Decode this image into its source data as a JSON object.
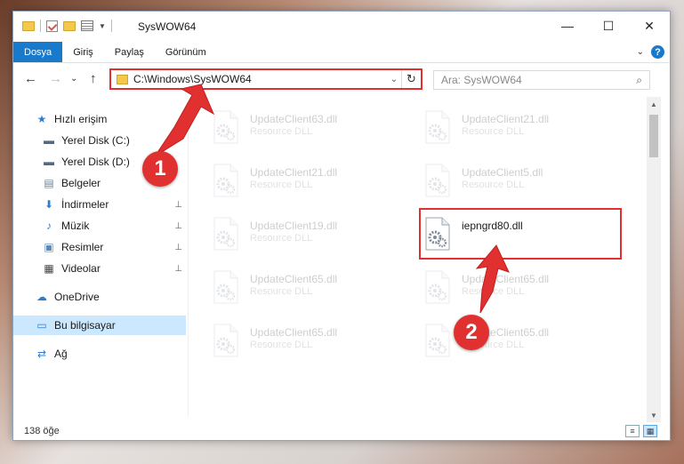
{
  "window": {
    "title": "SysWOW64",
    "controls": {
      "minimize": "—",
      "maximize": "☐",
      "close": "✕"
    }
  },
  "ribbon": {
    "tabs": [
      {
        "label": "Dosya",
        "active": true
      },
      {
        "label": "Giriş",
        "active": false
      },
      {
        "label": "Paylaş",
        "active": false
      },
      {
        "label": "Görünüm",
        "active": false
      }
    ],
    "help_caret": "⌄",
    "help_glyph": "?"
  },
  "address": {
    "path": "C:\\Windows\\SysWOW64",
    "dropdown_glyph": "⌄",
    "refresh_glyph": "↻"
  },
  "nav_buttons": {
    "back": "←",
    "forward": "→",
    "recent": "⌄",
    "up": "↑"
  },
  "search": {
    "placeholder": "Ara: SysWOW64",
    "icon_glyph": "⌕"
  },
  "sidebar": {
    "items": [
      {
        "label": "Hızlı erişim",
        "icon": "star-icon",
        "glyph": "★",
        "color": "#2a7fd4",
        "pinned": false
      },
      {
        "label": "Yerel Disk (C:)",
        "icon": "drive-icon",
        "glyph": "▬",
        "color": "#4f6b86",
        "pinned": false
      },
      {
        "label": "Yerel Disk (D:)",
        "icon": "drive-icon",
        "glyph": "▬",
        "color": "#4f6b86",
        "pinned": false
      },
      {
        "label": "Belgeler",
        "icon": "documents-icon",
        "glyph": "▤",
        "color": "#6b7f99",
        "pinned": false
      },
      {
        "label": "İndirmeler",
        "icon": "download-icon",
        "glyph": "⬇",
        "color": "#2a7fd4",
        "pinned": true
      },
      {
        "label": "Müzik",
        "icon": "music-icon",
        "glyph": "♪",
        "color": "#2a7fd4",
        "pinned": true
      },
      {
        "label": "Resimler",
        "icon": "pictures-icon",
        "glyph": "▣",
        "color": "#5a8ab8",
        "pinned": true
      },
      {
        "label": "Videolar",
        "icon": "video-icon",
        "glyph": "▦",
        "color": "#444",
        "pinned": true
      },
      {
        "label": "OneDrive",
        "icon": "cloud-icon",
        "glyph": "☁",
        "color": "#2a7fd4",
        "pinned": false
      },
      {
        "label": "Bu bilgisayar",
        "icon": "computer-icon",
        "glyph": "▭",
        "color": "#2a7fd4",
        "pinned": false,
        "selected": true
      },
      {
        "label": "Ağ",
        "icon": "network-icon",
        "glyph": "⇄",
        "color": "#2a7fd4",
        "pinned": false
      }
    ],
    "pin_glyph": "📌"
  },
  "files": [
    {
      "name": "UpdateClient63.dll",
      "type": "Resource DLL",
      "faded": true
    },
    {
      "name": "UpdateClient21.dll",
      "type": "Resource DLL",
      "faded": true
    },
    {
      "name": "UpdateClient21.dll",
      "type": "Resource DLL",
      "faded": true
    },
    {
      "name": "UpdateClient5.dll",
      "type": "Resource DLL",
      "faded": true
    },
    {
      "name": "UpdateClient19.dll",
      "type": "Resource DLL",
      "faded": true
    },
    {
      "name": "iepngrd80.dll",
      "type": "",
      "faded": false
    },
    {
      "name": "UpdateClient65.dll",
      "type": "Resource DLL",
      "faded": true
    },
    {
      "name": "UpdateClient65.dll",
      "type": "Resource DLL",
      "faded": true
    },
    {
      "name": "UpdateClient65.dll",
      "type": "Resource DLL",
      "faded": true
    },
    {
      "name": "UpdateClient65.dll",
      "type": "Resource DLL",
      "faded": true
    }
  ],
  "status": {
    "count": "138 öğe"
  },
  "callouts": [
    {
      "label": "1"
    },
    {
      "label": "2"
    }
  ],
  "colors": {
    "accent": "#1979ca",
    "callout": "#e03030",
    "selection": "#cce8ff"
  }
}
